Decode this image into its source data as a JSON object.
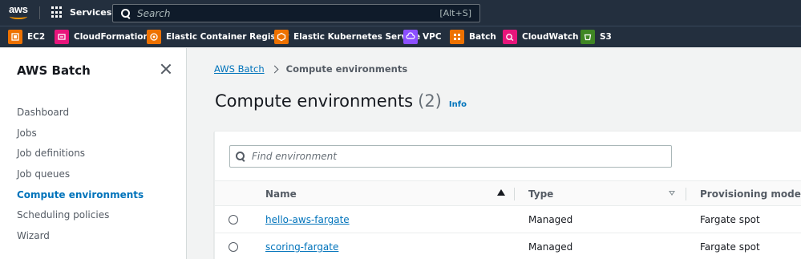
{
  "topnav": {
    "logo_text": "aws",
    "services_label": "Services",
    "search_placeholder": "Search",
    "search_shortcut": "[Alt+S]"
  },
  "favorites": [
    {
      "label": "EC2",
      "icon": "ec2-icon",
      "color": "#ed7100"
    },
    {
      "label": "CloudFormation",
      "icon": "cloudformation-icon",
      "color": "#e7157b"
    },
    {
      "label": "Elastic Container Registry",
      "icon": "ecr-icon",
      "color": "#ed7100"
    },
    {
      "label": "Elastic Kubernetes Service",
      "icon": "eks-icon",
      "color": "#ed7100"
    },
    {
      "label": "VPC",
      "icon": "vpc-icon",
      "color": "#8c4fff"
    },
    {
      "label": "Batch",
      "icon": "batch-icon",
      "color": "#ed7100"
    },
    {
      "label": "CloudWatch",
      "icon": "cloudwatch-icon",
      "color": "#e7157b"
    },
    {
      "label": "S3",
      "icon": "s3-icon",
      "color": "#3f8624"
    }
  ],
  "sidebar": {
    "title": "AWS Batch",
    "items": [
      {
        "label": "Dashboard",
        "active": false
      },
      {
        "label": "Jobs",
        "active": false
      },
      {
        "label": "Job definitions",
        "active": false
      },
      {
        "label": "Job queues",
        "active": false
      },
      {
        "label": "Compute environments",
        "active": true
      },
      {
        "label": "Scheduling policies",
        "active": false
      },
      {
        "label": "Wizard",
        "active": false
      }
    ]
  },
  "breadcrumb": {
    "root": "AWS Batch",
    "current": "Compute environments"
  },
  "page": {
    "title": "Compute environments",
    "count": "(2)",
    "info": "Info"
  },
  "table": {
    "filter_placeholder": "Find environment",
    "columns": [
      "Name",
      "Type",
      "Provisioning model"
    ],
    "rows": [
      {
        "name": "hello-aws-fargate",
        "type": "Managed",
        "provisioning": "Fargate spot"
      },
      {
        "name": "scoring-fargate",
        "type": "Managed",
        "provisioning": "Fargate spot"
      }
    ]
  },
  "colors": {
    "nav_bg": "#232f3e",
    "link": "#0073bb",
    "accent_orange": "#ff9900"
  }
}
